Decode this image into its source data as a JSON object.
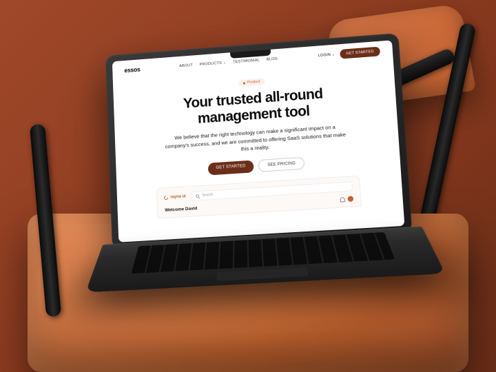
{
  "nav": {
    "logo": "essos",
    "links": [
      "ABOUT",
      "PRODUCTS",
      "TESTIMONIAL",
      "BLOG"
    ],
    "login": "LOGIN",
    "cta": "GET STARTED"
  },
  "hero": {
    "badge": "Product",
    "headline_l1": "Your trusted all-round",
    "headline_l2": "management tool",
    "subhead": "We believe that the right technology can make a significant impact on a company's success, and we are committed to offering SaaS solutions that make this a reality.",
    "primary": "GET STARTED",
    "secondary": "SEE PRICING"
  },
  "dashboard": {
    "brand": "rayna ui",
    "search_placeholder": "Search",
    "welcome": "Welcome David"
  }
}
